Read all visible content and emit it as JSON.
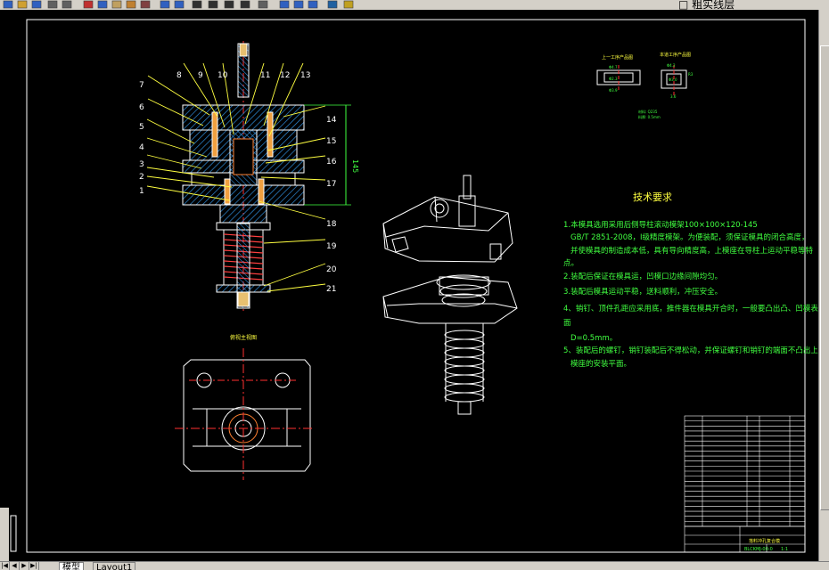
{
  "toolbar": {
    "current_layer": "粗实线层",
    "icons": [
      "new-icon",
      "open-icon",
      "save-icon",
      "print-icon",
      "preview-icon",
      "cut-icon",
      "copy-icon",
      "paste-icon",
      "match-prop-icon",
      "brush-icon",
      "undo-icon",
      "redo-icon",
      "pan-icon",
      "zoom-realtime-icon",
      "zoom-window-icon",
      "zoom-previous-icon",
      "properties-icon",
      "design-center-icon",
      "tool-palette-icon",
      "help-icon",
      "layer-manager-icon",
      "layer-state-icon"
    ]
  },
  "tabs": {
    "model": "模型",
    "layout1": "Layout1"
  },
  "drawing": {
    "part_numbers": [
      "1",
      "2",
      "3",
      "4",
      "5",
      "6",
      "7",
      "8",
      "9",
      "10",
      "11",
      "12",
      "13",
      "14",
      "15",
      "16",
      "17",
      "18",
      "19",
      "20",
      "21"
    ],
    "dimension_145": "145",
    "top_view_title": "俯视主视图",
    "process_title_1": "上一工序产品图",
    "process_title_2": "本道工序产品图",
    "process_dims": [
      "Φ4.7",
      "Φ2.3",
      "Φ3.9",
      "Φ4.2",
      "Φ3.0",
      "R3",
      "3.6"
    ],
    "material_note_1": "材料: Q235",
    "material_note_2": "料厚: 0.5mm",
    "tech_title": "技术要求",
    "tech_lines": [
      "1.本模具选用采用后侧导柱滚动模架100×100×120-145",
      "GB/T 2851-2008，I级精度模架。为便装配，须保证模具的闭合高度，",
      "并使模具的制造成本低，具有导向精度高，上模座在导柱上运动平稳等特",
      "点。",
      "2.装配后保证在模具运，凹模口边缘间隙均匀。",
      "3.装配后模具运动平稳，送料顺利，冲压安全。",
      "4、销钉、顶件孔距应采用底，推件器在模具开合时，一般要凸出凸、凹模表",
      "面",
      "D=0.5mm。",
      "5、装配后的螺钉，销钉装配后不得松动，并保证螺钉和销钉的端面不凸出上下",
      "模座的安装平面。"
    ],
    "title_block_label": "落料冲孔复合模",
    "title_block_code": "BLCKMJ-00-0",
    "title_block_scale": "1:1"
  }
}
